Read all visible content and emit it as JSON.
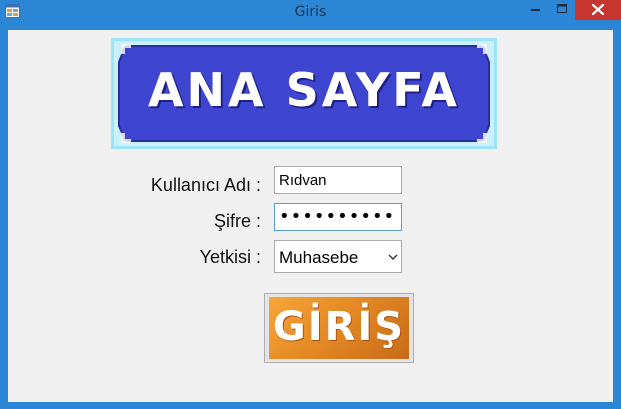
{
  "window": {
    "title": "Giris",
    "icon": "winforms-app-icon",
    "controls": [
      "minimize-icon",
      "maximize-icon",
      "close-icon"
    ],
    "accent": "#2b87d6",
    "close_color": "#c7372f"
  },
  "banner": {
    "text": "ANA SAYFA",
    "background": "#3e46d1",
    "frame_color": "#9fe4f5"
  },
  "form": {
    "username_label": "Kullanıcı Adı :",
    "username_value": "Rıdvan",
    "password_label": "Şifre :",
    "password_mask": "••••••••••",
    "role_label": "Yetkisi :",
    "role_value": "Muhasebe"
  },
  "login_button": {
    "label": "GİRİŞ",
    "color": "#e48a25"
  }
}
